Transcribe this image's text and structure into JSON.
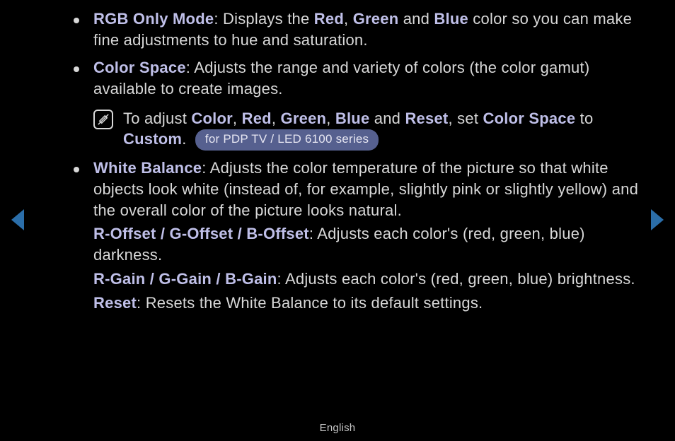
{
  "items": [
    {
      "term": "RGB Only Mode",
      "prefix": ": Displays the ",
      "links": {
        "a": "Red",
        "b": "Green",
        "c": "Blue"
      },
      "mid1": ", ",
      "mid2": " and ",
      "suffix": " color so you can make fine adjustments to hue and saturation."
    },
    {
      "term": "Color Space",
      "desc": ": Adjusts the range and variety of colors (the color gamut) available to create images.",
      "note": {
        "pre": "To adjust ",
        "a": "Color",
        "b": "Red",
        "c": "Green",
        "d": "Blue",
        "e": "Reset",
        "mid": ", set ",
        "target": "Color Space",
        "mid2": " to ",
        "value": "Custom",
        "end": ". "
      },
      "badge": "for PDP TV / LED 6100 series"
    },
    {
      "term": "White Balance",
      "desc": ": Adjusts the color temperature of the picture so that white objects look white (instead of, for example, slightly pink or slightly yellow) and the overall color of the picture looks natural.",
      "subs": [
        {
          "term": "R-Offset / G-Offset / B-Offset",
          "desc": ": Adjusts each color's (red, green, blue) darkness."
        },
        {
          "term": "R-Gain / G-Gain / B-Gain",
          "desc": ": Adjusts each color's (red, green, blue) brightness."
        },
        {
          "term": "Reset",
          "desc": ": Resets the White Balance to its default settings."
        }
      ]
    }
  ],
  "footer": "English"
}
